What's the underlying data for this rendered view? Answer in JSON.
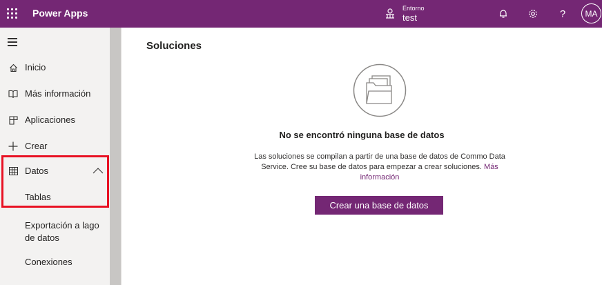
{
  "header": {
    "app_title": "Power Apps",
    "environment_label": "Entorno",
    "environment_name": "test",
    "help_glyph": "?",
    "avatar_initials": "MA",
    "icons": [
      "waffle-icon",
      "environment-icon",
      "bell-icon",
      "gear-icon",
      "help-icon"
    ],
    "brand_color": "#742774"
  },
  "sidebar": {
    "items": [
      {
        "label": "Inicio",
        "icon": "home-icon"
      },
      {
        "label": "Más información",
        "icon": "book-icon"
      },
      {
        "label": "Aplicaciones",
        "icon": "apps-icon"
      },
      {
        "label": "Crear",
        "icon": "plus-icon"
      },
      {
        "label": "Datos",
        "icon": "table-icon",
        "expanded": true
      },
      {
        "label": "Tablas"
      },
      {
        "label": "Exportación a lago de datos"
      },
      {
        "label": "Conexiones"
      }
    ],
    "highlight_color": "#e81123"
  },
  "main": {
    "title": "Soluciones",
    "empty_title": "No se encontró ninguna base de datos",
    "empty_desc": "Las soluciones se compilan a partir de una base de datos de Commo Data Service. Cree su base de datos para empezar a crear soluciones.",
    "more_info_link": "Más información",
    "create_button": "Crear una base de datos"
  }
}
